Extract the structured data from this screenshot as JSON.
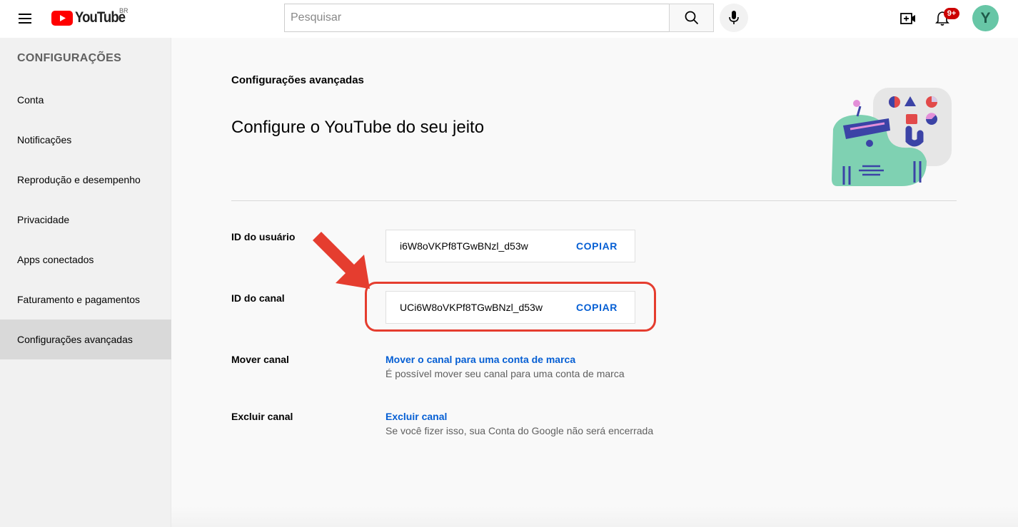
{
  "header": {
    "logo_text": "YouTube",
    "country_code": "BR",
    "search_placeholder": "Pesquisar",
    "notification_count": "9+",
    "avatar_letter": "Y"
  },
  "sidebar": {
    "heading": "CONFIGURAÇÕES",
    "items": [
      {
        "label": "Conta"
      },
      {
        "label": "Notificações"
      },
      {
        "label": "Reprodução e desempenho"
      },
      {
        "label": "Privacidade"
      },
      {
        "label": "Apps conectados"
      },
      {
        "label": "Faturamento e pagamentos"
      },
      {
        "label": "Configurações avançadas",
        "active": true
      }
    ]
  },
  "main": {
    "section_label": "Configurações avançadas",
    "hero_title": "Configure o YouTube do seu jeito",
    "user_id": {
      "label": "ID do usuário",
      "value": "i6W8oVKPf8TGwBNzl_d53w",
      "copy_label": "COPIAR"
    },
    "channel_id": {
      "label": "ID do canal",
      "value": "UCi6W8oVKPf8TGwBNzl_d53w",
      "copy_label": "COPIAR"
    },
    "move_channel": {
      "label": "Mover canal",
      "link": "Mover o canal para uma conta de marca",
      "description": "É possível mover seu canal para uma conta de marca"
    },
    "delete_channel": {
      "label": "Excluir canal",
      "link": "Excluir canal",
      "description": "Se você fizer isso, sua Conta do Google não será encerrada"
    }
  },
  "colors": {
    "brand_red": "#ff0000",
    "link_blue": "#065fd4",
    "annotation_red": "#e53d2f",
    "accent_green": "#7fd1b2"
  }
}
